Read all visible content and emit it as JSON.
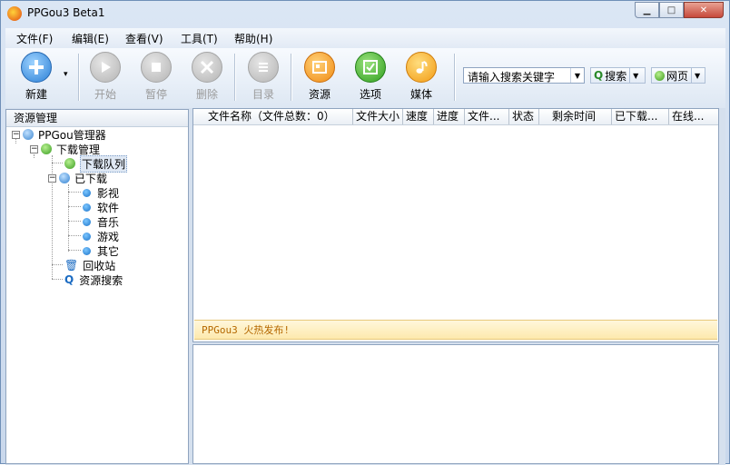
{
  "window": {
    "title": "PPGou3 Beta1",
    "minimize": "▁",
    "maximize": "□",
    "close": "✕"
  },
  "menu": [
    "文件(F)",
    "编辑(E)",
    "查看(V)",
    "工具(T)",
    "帮助(H)"
  ],
  "toolbar": {
    "new": "新建",
    "start": "开始",
    "pause": "暂停",
    "delete": "删除",
    "catalog": "目录",
    "resource": "资源",
    "options": "选项",
    "media": "媒体",
    "search_placeholder": "请输入搜索关键字",
    "search_button": "搜索",
    "web_button": "网页"
  },
  "tree": {
    "header": "资源管理",
    "root": "PPGou管理器",
    "download_mgmt": "下载管理",
    "download_queue": "下载队列",
    "downloaded": "已下载",
    "categories": [
      "影视",
      "软件",
      "音乐",
      "游戏",
      "其它"
    ],
    "recycle": "回收站",
    "resource_search": "资源搜索"
  },
  "list": {
    "columns": [
      "文件名称（文件总数：0）",
      "文件大小",
      "速度",
      "进度",
      "文件...",
      "状态",
      "剩余时间",
      "已下载...",
      "在线..."
    ],
    "notice": "PPGou3 火热发布!"
  },
  "colors": {
    "accent_orange": "#f5a623",
    "accent_green": "#3fae2a",
    "accent_blue": "#1b73c9",
    "notice_text": "#b56800"
  }
}
